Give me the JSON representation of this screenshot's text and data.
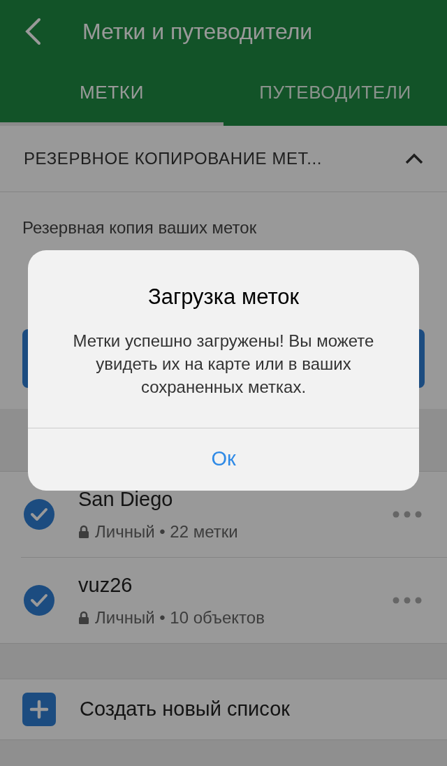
{
  "header": {
    "title": "Метки и путеводители"
  },
  "tabs": [
    {
      "label": "МЕТКИ",
      "selected": true
    },
    {
      "label": "ПУТЕВОДИТЕЛИ",
      "selected": false
    }
  ],
  "backup": {
    "title": "РЕЗЕРВНОЕ КОПИРОВАНИЕ МЕТ...",
    "expanded": true,
    "text": "Резервная копия ваших меток"
  },
  "lists": [
    {
      "name": "San Diego",
      "meta": "Личный • 22 метки",
      "checked": true
    },
    {
      "name": "vuz26",
      "meta": "Личный • 10 объектов",
      "checked": true
    }
  ],
  "create": {
    "label": "Создать новый список"
  },
  "dialog": {
    "title": "Загрузка меток",
    "message": "Метки успешно загружены! Вы можете увидеть их на карте или в ваших сохраненных метках.",
    "button": "Ок"
  }
}
